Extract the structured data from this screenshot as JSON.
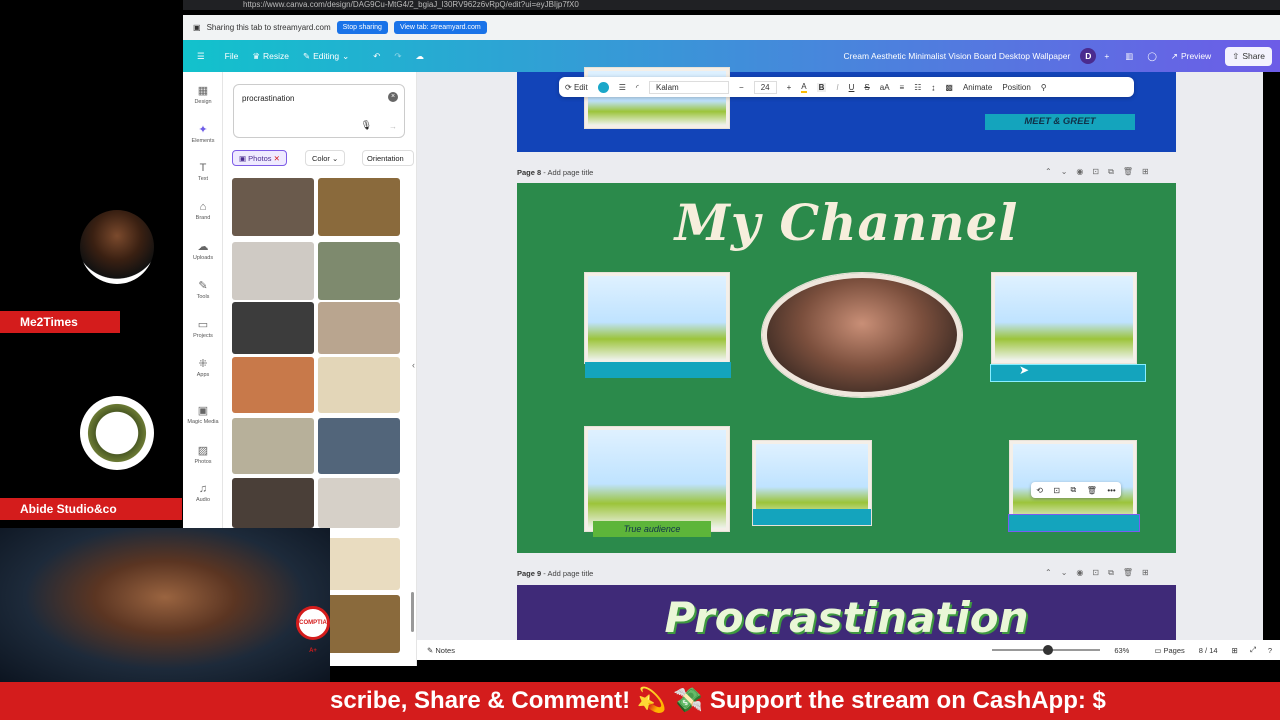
{
  "browser": {
    "url": "https://www.canva.com/design/DAG9Cu-MtG4/2_bgiaJ_l30RV962z6vRpQ/edit?ui=eyJBIjp7fX0"
  },
  "share_bar": {
    "text": "Sharing this tab to streamyard.com",
    "stop_label": "Stop sharing",
    "view_label": "View tab: streamyard.com",
    "colors": {
      "stop": "#1a73e8",
      "view": "#1a73e8"
    }
  },
  "topbar": {
    "file": "File",
    "resize": "Resize",
    "editing": "Editing",
    "title": "Cream Aesthetic Minimalist Vision Board Desktop Wallpaper",
    "avatar_initial": "D",
    "preview": "Preview",
    "share": "Share",
    "gradient": [
      "#12c2cc",
      "#6d5ce7"
    ]
  },
  "rail": {
    "items": [
      "Design",
      "Elements",
      "Text",
      "Brand",
      "Uploads",
      "Tools",
      "Projects",
      "Apps",
      "Magic Media",
      "Photos",
      "Audio"
    ]
  },
  "panel": {
    "search_value": "procrastination",
    "chips": [
      "Photos",
      "Color",
      "Orientation"
    ]
  },
  "toolbar": {
    "edit": "Edit",
    "font": "Kalam",
    "size": "24",
    "animate": "Animate",
    "position": "Position"
  },
  "page7": {
    "banner_text": "MEET & GREET"
  },
  "page8": {
    "label_num": "Page 8",
    "label_title": "- Add page title",
    "heading": "My Channel",
    "ribbon_text": "True audience",
    "bg": "#2b8a4b"
  },
  "page9": {
    "label_num": "Page 9",
    "label_title": "- Add page title",
    "heading": "Procrastination",
    "bg": "#3f2a78"
  },
  "bottombar": {
    "notes": "Notes",
    "zoom": "63%",
    "pages": "Pages",
    "page_count": "8 / 14",
    "zoom_level": 0.63
  },
  "overlay": {
    "name1": "Me2Times",
    "name2": "Abide Studio&co",
    "ticker": "scribe, Share & Comment! 💫 💸 Support the stream on CashApp: $",
    "overlay_text": "COMPTIA A+",
    "accent": "#d41c1c"
  }
}
